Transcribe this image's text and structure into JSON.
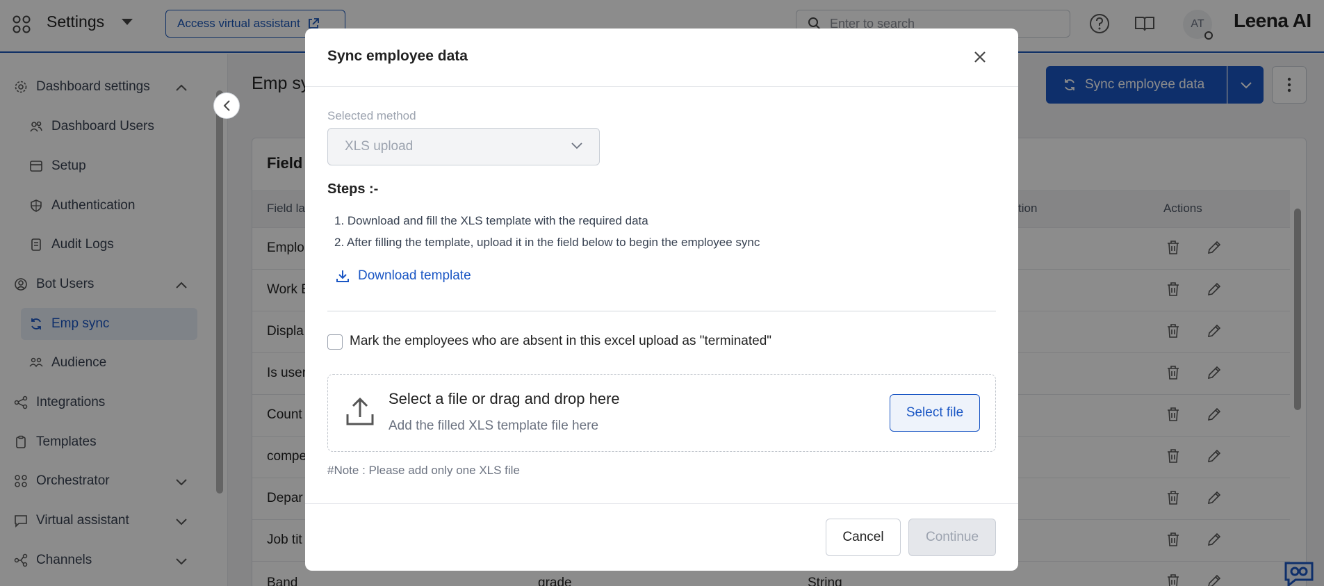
{
  "header": {
    "app_title": "Settings",
    "assistant_button": "Access virtual assistant",
    "search_placeholder": "Enter to search",
    "avatar_initials": "AT",
    "brand": "Leena AI"
  },
  "sidebar": {
    "items": [
      {
        "label": "Dashboard settings",
        "icon": "gear-icon",
        "expanded": true
      },
      {
        "label": "Dashboard Users",
        "icon": "users-icon"
      },
      {
        "label": "Setup",
        "icon": "setup-icon"
      },
      {
        "label": "Authentication",
        "icon": "shield-icon"
      },
      {
        "label": "Audit Logs",
        "icon": "document-icon"
      },
      {
        "label": "Bot Users",
        "icon": "user-circle-icon",
        "expanded": true
      },
      {
        "label": "Emp sync",
        "icon": "sync-icon",
        "active": true
      },
      {
        "label": "Audience",
        "icon": "audience-icon"
      },
      {
        "label": "Integrations",
        "icon": "integrations-icon"
      },
      {
        "label": "Templates",
        "icon": "clipboard-icon"
      },
      {
        "label": "Orchestrator",
        "icon": "orchestrator-icon",
        "expanded": false
      },
      {
        "label": "Virtual assistant",
        "icon": "chat-icon",
        "expanded": false
      },
      {
        "label": "Channels",
        "icon": "channels-icon",
        "expanded": false
      }
    ]
  },
  "page": {
    "title": "Emp sy",
    "sync_button": "Sync employee data",
    "card_title": "Field",
    "columns": [
      "Field la",
      "tion",
      "Actions"
    ],
    "rows": [
      {
        "c1": "Emplo",
        "c2": "",
        "c3": ""
      },
      {
        "c1": "Work E",
        "c2": "",
        "c3": ""
      },
      {
        "c1": "Displa",
        "c2": "",
        "c3": ""
      },
      {
        "c1": "Is user",
        "c2": "",
        "c3": ""
      },
      {
        "c1": "Count",
        "c2": "",
        "c3": ""
      },
      {
        "c1": "compe",
        "c2": "",
        "c3": ""
      },
      {
        "c1": "Depar",
        "c2": "",
        "c3": ""
      },
      {
        "c1": "Job tit",
        "c2": "",
        "c3": ""
      },
      {
        "c1": "Band",
        "c2": "grade",
        "c3": "String"
      }
    ]
  },
  "modal": {
    "title": "Sync employee data",
    "method_label": "Selected method",
    "method_value": "XLS upload",
    "steps_heading": "Steps :-",
    "steps": [
      "1. Download and fill the XLS template with the required data",
      "2. After filling the template, upload it in the field below to begin the employee sync"
    ],
    "download_link": "Download template",
    "checkbox_label": "Mark the employees who are absent in this excel upload as \"terminated\"",
    "checkbox_checked": false,
    "drop_title": "Select a file or drag and drop here",
    "drop_subtitle": "Add the filled XLS template file here",
    "select_file_button": "Select file",
    "note": "#Note : Please add only one XLS file",
    "cancel_button": "Cancel",
    "continue_button": "Continue"
  },
  "colors": {
    "accent": "#1a56c4",
    "overlay": "rgba(0,0,0,0.45)"
  }
}
